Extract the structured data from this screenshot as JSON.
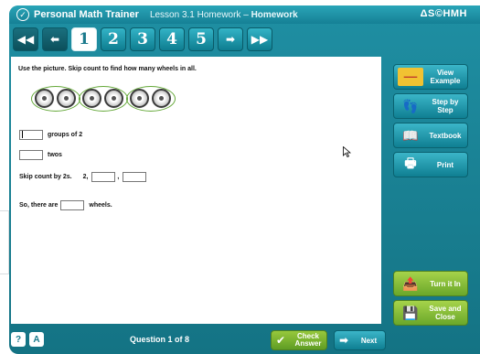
{
  "window": {
    "app_title": "Personal Math Trainer",
    "lesson_title": "Lesson 3.1 Homework – ",
    "lesson_title_bold": "Homework",
    "brand": "HMH",
    "brand_prefix": "ΔS©"
  },
  "nav": {
    "first_icon": "double-left-arrow-icon",
    "prev_icon": "left-arrow-icon",
    "pages": [
      "1",
      "2",
      "3",
      "4",
      "5"
    ],
    "active_page": "1",
    "next_icon": "right-arrow-icon",
    "last_icon": "double-right-arrow-icon"
  },
  "question": {
    "prompt": "Use the picture. Skip count to find how many wheels in all.",
    "wheel_groups": 3,
    "wheels_per_group": 2,
    "groups_label": "groups of 2",
    "twos_label": "twos",
    "skip_count_label": "Skip count by 2s.",
    "skip_count_start": "2,",
    "skip_count_sep": ",",
    "conclusion_prefix": "So, there are",
    "conclusion_suffix": "wheels.",
    "inputs": {
      "groups": "",
      "twos": "",
      "skip1": "",
      "skip2": "",
      "wheels": ""
    }
  },
  "sidebar": {
    "view_example": "View Example",
    "step_by_step": "Step by Step",
    "textbook": "Textbook",
    "print": "Print",
    "turn_it_in": "Turn it In",
    "save_and_close": "Save and Close"
  },
  "footer": {
    "help_label": "?",
    "alert_label": "A",
    "question_count": "Question 1 of 8",
    "check_answer": "Check Answer",
    "next": "Next"
  },
  "colors": {
    "frame": "#147384",
    "accent_teal": "#1f8fa3",
    "green_button": "#6aa72a",
    "wheel_outline": "#64a838"
  }
}
